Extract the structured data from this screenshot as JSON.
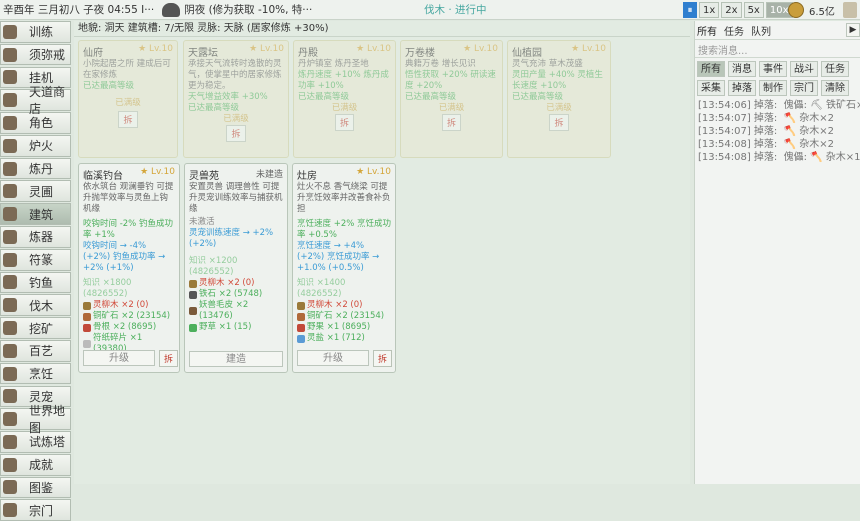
{
  "topbar": {
    "date": "辛酉年 三月初八 子夜 04:55 I···",
    "weather": "阴夜 (修为获取 -10%, 特···",
    "task": "伐木 · 进行中",
    "speeds": [
      "1x",
      "2x",
      "5x",
      "10x"
    ],
    "money": "6.5亿"
  },
  "nav": [
    {
      "label": "训练",
      "icon": "training-icon"
    },
    {
      "label": "须弥戒",
      "icon": "ring-icon"
    },
    {
      "label": "挂机",
      "icon": "afk-icon"
    },
    {
      "label": "天道商店",
      "icon": "shop-icon"
    },
    {
      "label": "角色",
      "icon": "character-icon"
    },
    {
      "label": "炉火",
      "icon": "furnace-icon"
    },
    {
      "label": "炼丹",
      "icon": "alchemy-icon"
    },
    {
      "label": "灵圃",
      "icon": "garden-icon"
    },
    {
      "label": "建筑",
      "icon": "building-icon"
    },
    {
      "label": "炼器",
      "icon": "forge-icon"
    },
    {
      "label": "符篆",
      "icon": "talisman-icon"
    },
    {
      "label": "钓鱼",
      "icon": "fishing-icon"
    },
    {
      "label": "伐木",
      "icon": "axe-icon"
    },
    {
      "label": "挖矿",
      "icon": "pickaxe-icon"
    },
    {
      "label": "百艺",
      "icon": "crafts-icon"
    },
    {
      "label": "烹饪",
      "icon": "cooking-icon"
    },
    {
      "label": "灵宠",
      "icon": "pet-icon"
    },
    {
      "label": "世界地图",
      "icon": "map-icon"
    },
    {
      "label": "试炼塔",
      "icon": "tower-icon"
    },
    {
      "label": "成就",
      "icon": "trophy-icon"
    },
    {
      "label": "图鉴",
      "icon": "book-icon"
    },
    {
      "label": "宗门",
      "icon": "sect-icon"
    }
  ],
  "infobar": "地貌: 洞天   建筑槽: 7/无限   灵脉: 天脉 (居家修炼 +30%)",
  "cards_top": [
    {
      "title": "仙府",
      "level": "Lv.10",
      "desc": "小院起居之所 建成后可在家修炼",
      "lines": [
        "已达最高等级"
      ],
      "status": "已满级",
      "demolish": "拆"
    },
    {
      "title": "天露坛",
      "level": "Lv.10",
      "desc": "承接天气流转时逸散的灵气，使掌星中的居家修炼更为稳定。",
      "lines": [
        "天气增益效率 +30%",
        "已达最高等级"
      ],
      "status": "已满级",
      "demolish": "拆"
    },
    {
      "title": "丹殿",
      "level": "Lv.10",
      "desc": "丹炉镇室 炼丹圣地",
      "lines": [
        "炼丹速度 +10% 炼丹成功率 +10%",
        "已达最高等级"
      ],
      "status": "已满级",
      "demolish": "拆"
    },
    {
      "title": "万卷楼",
      "level": "Lv.10",
      "desc": "典籍万卷 增长见识",
      "lines": [
        "悟性获取 +20% 研读速度 +20%",
        "已达最高等级"
      ],
      "status": "已满级",
      "demolish": "拆"
    },
    {
      "title": "仙植园",
      "level": "Lv.10",
      "desc": "灵气充沛 草木茂盛",
      "lines": [
        "灵田产量 +40% 灵植生长速度 +10%",
        "已达最高等级"
      ],
      "status": "已满级",
      "demolish": "拆"
    }
  ],
  "card_fishing": {
    "title": "临溪钓台",
    "level": "Lv.10",
    "desc": "依水筑台 观澜垂钓 可提升抛竿效率与灵鱼上钩机缘",
    "lines": [
      "咬钩时间 -2% 钓鱼成功率 +1%",
      "咬钩时间 → -4%",
      "(+2%) 钓鱼成功率 → +2% (+1%)"
    ],
    "cost": "知识 ×1800 (4826552)",
    "mats": [
      "灵柳木 ×2 (0)",
      "铜矿石 ×2 (23154)",
      "骨根 ×2 (8695)",
      "符纸碎片 ×1 (39380)"
    ],
    "upgrade": "升级",
    "demolish": "拆"
  },
  "card_beast": {
    "title": "灵兽苑",
    "state": "未建造",
    "desc": "安置灵兽 调理兽性 可提升灵宠训练效率与捕获机缘",
    "sub": "未激活",
    "lines": [
      "灵宠训练速度 → +2% (+2%)"
    ],
    "cost": "知识 ×1200 (4826552)",
    "mats": [
      "灵柳木 ×2 (0)",
      "铁石 ×2 (5748)",
      "妖兽毛皮 ×2 (13476)",
      "野草 ×1 (15)"
    ],
    "build": "建造"
  },
  "card_kitchen": {
    "title": "灶房",
    "level": "Lv.10",
    "desc": "灶火不息 香气绕梁 可提升烹饪效率并改善食补负担",
    "lines": [
      "烹饪速度 +2% 烹饪成功率 +0.5%",
      "烹饪速度 → +4%",
      "(+2%) 烹饪成功率 → +1.0% (+0.5%)"
    ],
    "cost": "知识 ×1400 (4826552)",
    "mats": [
      "灵柳木 ×2 (0)",
      "铜矿石 ×2 (23154)",
      "野果 ×1 (8695)",
      "灵盐 ×1 (712)"
    ],
    "upgrade": "升级",
    "demolish": "拆"
  },
  "right": {
    "tabs": [
      "所有",
      "任务",
      "队列"
    ],
    "search_placeholder": "搜索消息...",
    "filters": [
      "所有",
      "消息",
      "事件",
      "战斗",
      "任务",
      "采集",
      "掉落",
      "制作",
      "宗门",
      "清除"
    ],
    "logs": [
      "[13:54:06] 掉落:  傀儡: ⛏ 铁矿石×2",
      "[13:54:07] 掉落:  🪓 杂木×2",
      "[13:54:07] 掉落:  🪓 杂木×2",
      "[13:54:08] 掉落:  🪓 杂木×2",
      "[13:54:08] 掉落:  傀儡: 🪓 杂木×1"
    ]
  }
}
